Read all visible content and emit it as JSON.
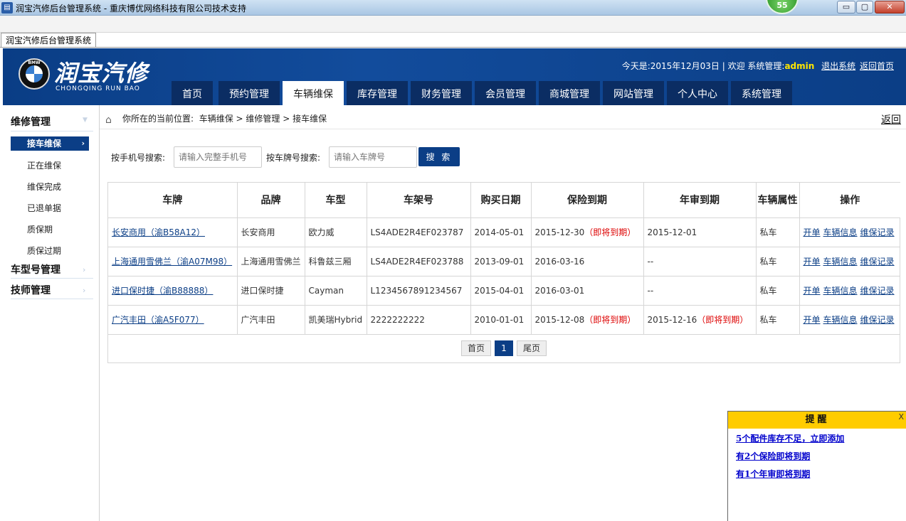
{
  "window": {
    "title": "润宝汽修后台管理系统 - 重庆博优网络科技有限公司技术支持",
    "badge": "55",
    "min_label": "▭",
    "max_label": "▢",
    "close_label": "✕"
  },
  "browser_tab": "润宝汽修后台管理系统",
  "header": {
    "logo_cn": "润宝汽修",
    "logo_en": "CHONGQING RUN BAO",
    "logo_mark": "BMW",
    "date_prefix": "今天是:",
    "date": "2015年12月03日",
    "separator": "|",
    "welcome": "欢迎",
    "role": "系统管理:",
    "user": "admin",
    "logout": "退出系统",
    "home_link": "返回首页"
  },
  "nav": [
    {
      "label": "首页",
      "active": false
    },
    {
      "label": "预约管理",
      "active": false
    },
    {
      "label": "车辆维保",
      "active": true
    },
    {
      "label": "库存管理",
      "active": false
    },
    {
      "label": "财务管理",
      "active": false
    },
    {
      "label": "会员管理",
      "active": false
    },
    {
      "label": "商城管理",
      "active": false
    },
    {
      "label": "网站管理",
      "active": false
    },
    {
      "label": "个人中心",
      "active": false
    },
    {
      "label": "系统管理",
      "active": false
    }
  ],
  "sidebar": {
    "group1": "维修管理",
    "active_item": "接车维保",
    "items": [
      "正在维保",
      "维保完成",
      "已退单据",
      "质保期",
      "质保过期"
    ],
    "group2": "车型号管理",
    "group3": "技师管理"
  },
  "breadcrumb": {
    "prefix": "你所在的当前位置:",
    "path1": "车辆维保",
    "path2": "维修管理",
    "path3": "接车维保",
    "arrow": ">"
  },
  "back": "返回",
  "search": {
    "phone_label": "按手机号搜索:",
    "phone_placeholder": "请输入完整手机号",
    "plate_label": "按车牌号搜索:",
    "plate_placeholder": "请输入车牌号",
    "button": "搜 索"
  },
  "table": {
    "headers": [
      "车牌",
      "品牌",
      "车型",
      "车架号",
      "购买日期",
      "保险到期",
      "年审到期",
      "车辆属性",
      "操作"
    ],
    "rows": [
      {
        "plate": "长安商用（渝B58A12）",
        "brand": "长安商用",
        "model": "欧力威",
        "vin": "LS4ADE2R4EF023787",
        "buy_date": "2014-05-01",
        "insurance": "2015-12-30",
        "insurance_warn": "（即将到期）",
        "annual": "2015-12-01",
        "annual_warn": "",
        "attr": "私车"
      },
      {
        "plate": "上海通用雪佛兰（渝A07M98）",
        "brand": "上海通用雪佛兰",
        "model": "科鲁兹三厢",
        "vin": "LS4ADE2R4EF023788",
        "buy_date": "2013-09-01",
        "insurance": "2016-03-16",
        "insurance_warn": "",
        "annual": "--",
        "annual_warn": "",
        "attr": "私车"
      },
      {
        "plate": "进口保时捷（渝B88888）",
        "brand": "进口保时捷",
        "model": "Cayman",
        "vin": "L1234567891234567",
        "buy_date": "2015-04-01",
        "insurance": "2016-03-01",
        "insurance_warn": "",
        "annual": "--",
        "annual_warn": "",
        "attr": "私车"
      },
      {
        "plate": "广汽丰田（渝A5F077）",
        "brand": "广汽丰田",
        "model": "凯美瑞Hybrid",
        "vin": "2222222222",
        "buy_date": "2010-01-01",
        "insurance": "2015-12-08",
        "insurance_warn": "（即将到期）",
        "annual": "2015-12-16",
        "annual_warn": "（即将到期）",
        "attr": "私车"
      }
    ],
    "ops": [
      "开单",
      "车辆信息",
      "维保记录"
    ]
  },
  "pager": {
    "first": "首页",
    "current": "1",
    "last": "尾页"
  },
  "reminder": {
    "title": "提醒",
    "close": "X",
    "items": [
      "5个配件库存不足，立即添加",
      "有2个保险即将到期",
      "有1个年审即将到期"
    ]
  },
  "colors": {
    "brand": "#0b3e86",
    "warn": "#dd0000",
    "reminder_header": "#ffcc00"
  }
}
